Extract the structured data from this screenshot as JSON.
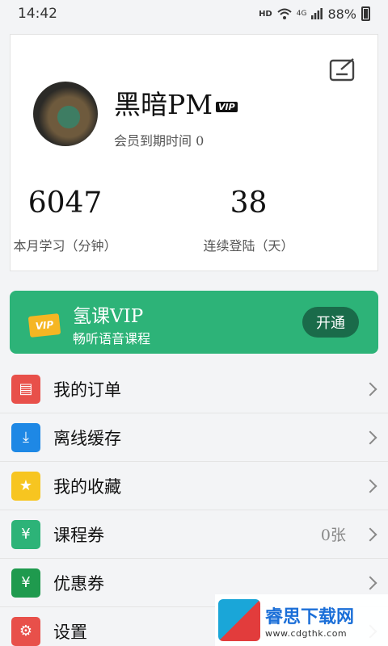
{
  "status_bar": {
    "time": "14:42",
    "hd_label": "HD",
    "network_label": "4G",
    "battery_text": "88%",
    "icons": [
      "wifi-icon",
      "signal-icon",
      "battery-icon"
    ]
  },
  "profile": {
    "username": "黑暗PM",
    "vip_badge": "VIP",
    "member_line": "会员到期时间 0",
    "stats": [
      {
        "value": "6047",
        "label": "本月学习（分钟）"
      },
      {
        "value": "38",
        "label": "连续登陆（天）"
      }
    ],
    "edit_icon": "edit-icon"
  },
  "vip_banner": {
    "badge": "VIP",
    "title": "氢课VIP",
    "subtitle": "畅听语音课程",
    "button": "开通",
    "color": "#2db378"
  },
  "menu": [
    {
      "label": "我的订单",
      "icon": "order-icon",
      "icon_color": "#e8504a",
      "icon_glyph": "▤",
      "value": ""
    },
    {
      "label": "离线缓存",
      "icon": "download-icon",
      "icon_color": "#1e88e5",
      "icon_glyph": "⤓",
      "value": ""
    },
    {
      "label": "我的收藏",
      "icon": "star-icon",
      "icon_color": "#f7c520",
      "icon_glyph": "★",
      "value": ""
    },
    {
      "label": "课程券",
      "icon": "course-coupon-icon",
      "icon_color": "#2db378",
      "icon_glyph": "¥",
      "value": "0张"
    },
    {
      "label": "优惠券",
      "icon": "coupon-icon",
      "icon_color": "#1f9a4e",
      "icon_glyph": "¥",
      "value": ""
    },
    {
      "label": "设置",
      "icon": "gear-icon",
      "icon_color": "#e8504a",
      "icon_glyph": "⚙",
      "value": ""
    }
  ],
  "watermark": {
    "name": "睿思下载网",
    "url": "www.cdgthk.com"
  }
}
